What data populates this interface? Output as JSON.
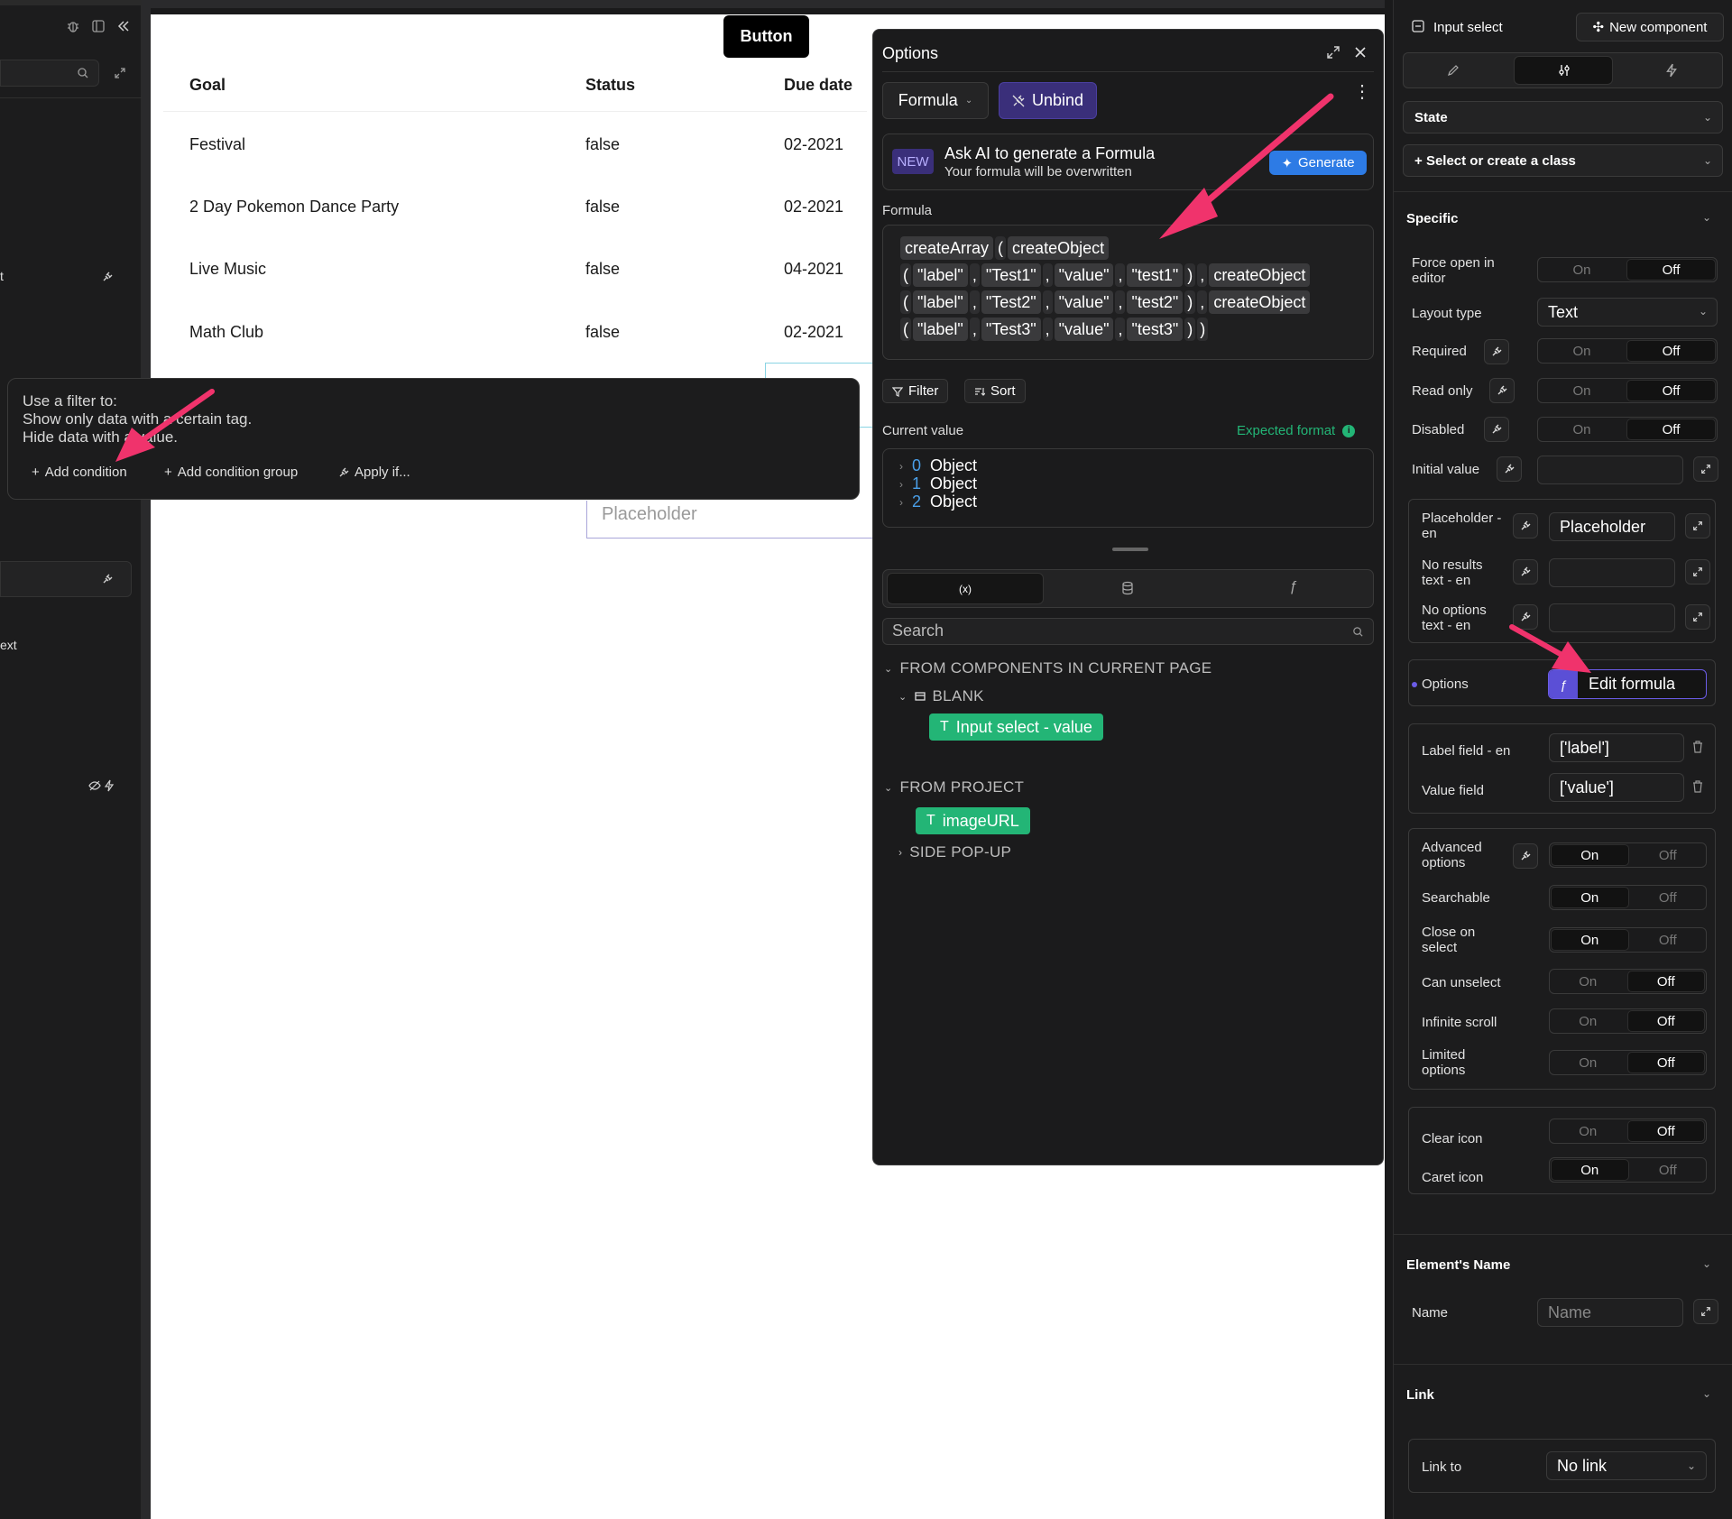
{
  "canvas": {
    "button_label": "Button",
    "table": {
      "headers": [
        "Goal",
        "Status",
        "Due date"
      ],
      "rows": [
        [
          "Festival",
          "false",
          "02-2021"
        ],
        [
          "2 Day Pokemon Dance Party",
          "false",
          "02-2021"
        ],
        [
          "Live Music",
          "false",
          "04-2021"
        ],
        [
          "Math Club",
          "false",
          "02-2021"
        ]
      ]
    },
    "placeholder": "Placeholder"
  },
  "left_panel": {
    "fragment_t": "t",
    "fragment_ext": "ext"
  },
  "filter_popup": {
    "lines": [
      "Use a filter to:",
      "Show only data with a certain tag.",
      "Hide data with a value."
    ],
    "add_condition": "Add condition",
    "add_condition_group": "Add condition group",
    "apply_if": "Apply if..."
  },
  "options_panel": {
    "title": "Options",
    "formula_btn": "Formula",
    "unbind_btn": "Unbind",
    "ai_badge": "NEW",
    "ai_title": "Ask AI to generate a Formula",
    "ai_subtitle": "Your formula will be overwritten",
    "generate_btn": "Generate",
    "formula_label": "Formula",
    "formula_lines": [
      [
        "createArray",
        "(",
        "createObject"
      ],
      [
        "(",
        "\"label\"",
        ",",
        "\"Test1\"",
        ",",
        "\"value\"",
        ",",
        "\"test1\"",
        ")",
        ",",
        "createObject"
      ],
      [
        "(",
        "\"label\"",
        ",",
        "\"Test2\"",
        ",",
        "\"value\"",
        ",",
        "\"test2\"",
        ")",
        ",",
        "createObject"
      ],
      [
        "(",
        "\"label\"",
        ",",
        "\"Test3\"",
        ",",
        "\"value\"",
        ",",
        "\"test3\"",
        ")",
        ")"
      ]
    ],
    "filter_btn": "Filter",
    "sort_btn": "Sort",
    "current_value_label": "Current value",
    "expected_format": "Expected format",
    "current_values": [
      {
        "index": "0",
        "type": "Object"
      },
      {
        "index": "1",
        "type": "Object"
      },
      {
        "index": "2",
        "type": "Object"
      }
    ],
    "tab_vars": "(x)",
    "search_placeholder": "Search",
    "tree": {
      "section1": "FROM COMPONENTS IN CURRENT PAGE",
      "blank": "BLANK",
      "input_select_value": "Input select - value",
      "section2": "FROM PROJECT",
      "image_url": "imageURL",
      "side_popup": "SIDE POP-UP"
    }
  },
  "right_panel": {
    "component_name": "Input select",
    "new_component": "New component",
    "state_label": "State",
    "class_select": "Select or create a class",
    "specific_label": "Specific",
    "toggle_on": "On",
    "toggle_off": "Off",
    "force_open_label": "Force open in editor",
    "layout_type_label": "Layout type",
    "layout_type_value": "Text",
    "required_label": "Required",
    "read_only_label": "Read only",
    "disabled_label": "Disabled",
    "initial_value_label": "Initial value",
    "placeholder_label": "Placeholder - en",
    "placeholder_value": "Placeholder",
    "no_results_label": "No results text - en",
    "no_options_label": "No options text - en",
    "options_label": "Options",
    "edit_formula": "Edit formula",
    "label_field_label": "Label field - en",
    "label_field_value": "['label']",
    "value_field_label": "Value field",
    "value_field_value": "['value']",
    "advanced_options_label": "Advanced options",
    "searchable_label": "Searchable",
    "close_on_select_label": "Close on select",
    "can_unselect_label": "Can unselect",
    "infinite_scroll_label": "Infinite scroll",
    "limited_options_label": "Limited options",
    "clear_icon_label": "Clear icon",
    "caret_icon_label": "Caret icon",
    "elements_name_label": "Element's Name",
    "name_label": "Name",
    "name_placeholder": "Name",
    "link_label": "Link",
    "link_to_label": "Link to",
    "link_to_value": "No link"
  },
  "colors": {
    "accent_purple": "#5b4fd6",
    "green_tag": "#23b576",
    "generate_blue": "#2d7be5",
    "annotation_arrow": "#f0336c"
  }
}
